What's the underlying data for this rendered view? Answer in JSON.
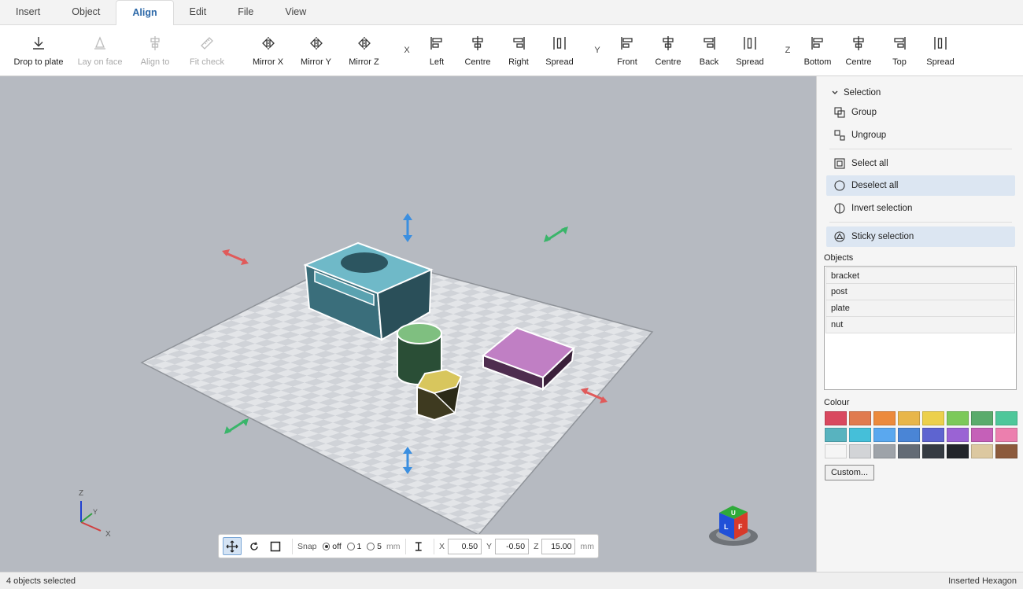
{
  "tabs": [
    {
      "label": "Insert"
    },
    {
      "label": "Object"
    },
    {
      "label": "Align"
    },
    {
      "label": "Edit"
    },
    {
      "label": "File"
    },
    {
      "label": "View"
    }
  ],
  "ribbon": {
    "drop_to_plate": "Drop to plate",
    "lay_on_face": "Lay on face",
    "align_to": "Align to",
    "fit_check": "Fit check",
    "mirror_x": "Mirror X",
    "mirror_y": "Mirror Y",
    "mirror_z": "Mirror Z",
    "x_label": "X",
    "x_left": "Left",
    "x_centre": "Centre",
    "x_right": "Right",
    "x_spread": "Spread",
    "y_label": "Y",
    "y_front": "Front",
    "y_centre": "Centre",
    "y_back": "Back",
    "y_spread": "Spread",
    "z_label": "Z",
    "z_bottom": "Bottom",
    "z_centre": "Centre",
    "z_top": "Top",
    "z_spread": "Spread"
  },
  "viewport": {
    "axis_z": "Z",
    "axis_y": "Y",
    "axis_x": "X",
    "cube_up": "U",
    "cube_left": "L",
    "cube_front": "F"
  },
  "vtool": {
    "snap_label": "Snap",
    "snap_off": "off",
    "snap_1": "1",
    "snap_5": "5",
    "snap_unit": "mm",
    "x_label": "X",
    "x_value": "0.50",
    "y_label": "Y",
    "y_value": "-0.50",
    "z_label": "Z",
    "z_value": "15.00",
    "z_unit": "mm"
  },
  "side": {
    "selection_title": "Selection",
    "group": "Group",
    "ungroup": "Ungroup",
    "select_all": "Select all",
    "deselect_all": "Deselect all",
    "invert_selection": "Invert selection",
    "sticky_selection": "Sticky selection",
    "objects_title": "Objects",
    "objects": [
      "bracket",
      "post",
      "plate",
      "nut"
    ],
    "colour_title": "Colour",
    "colours": [
      "#d9485f",
      "#e07b50",
      "#ec8a3c",
      "#e8b64a",
      "#ecd04c",
      "#7cc95a",
      "#5aab6c",
      "#4ec79a",
      "#58b3bf",
      "#45bfd9",
      "#5aa8ef",
      "#4a85d6",
      "#5e64d0",
      "#9a63d4",
      "#c560b8",
      "#ec7fae",
      "#f5f5f5",
      "#d2d4d7",
      "#9ea3a9",
      "#636b75",
      "#353b42",
      "#22252a",
      "#dcc8a0",
      "#8c5a3c"
    ],
    "custom_button": "Custom..."
  },
  "status": {
    "left": "4 objects selected",
    "right": "Inserted Hexagon"
  }
}
